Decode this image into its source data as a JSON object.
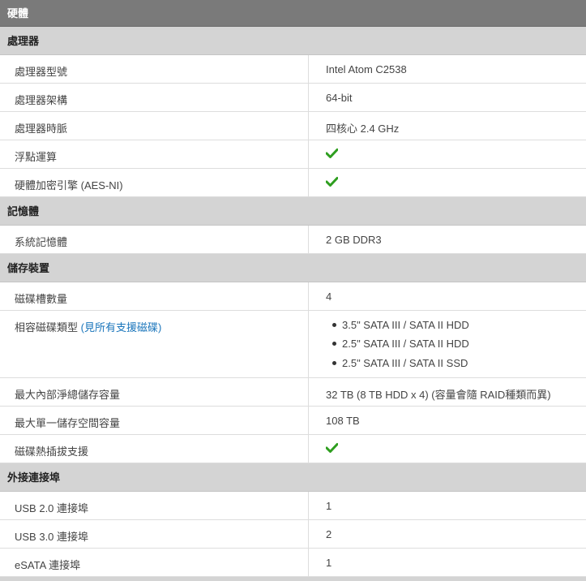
{
  "title": "硬體",
  "colors": {
    "check": "#2e9e1f",
    "link": "#1a75bb"
  },
  "sections": {
    "cpu": {
      "title": "處理器",
      "model_label": "處理器型號",
      "model_value": "Intel Atom C2538",
      "arch_label": "處理器架構",
      "arch_value": "64-bit",
      "freq_label": "處理器時脈",
      "freq_value": "四核心 2.4 GHz",
      "fpu_label": "浮點運算",
      "fpu_value_icon": "checkmark-icon",
      "aes_label": "硬體加密引擎 (AES-NI)",
      "aes_value_icon": "checkmark-icon"
    },
    "memory": {
      "title": "記憶體",
      "ram_label": "系統記憶體",
      "ram_value": "2 GB DDR3"
    },
    "storage": {
      "title": "儲存裝置",
      "bays_label": "磁碟槽數量",
      "bays_value": "4",
      "types_label": "相容磁碟類型",
      "types_link": "(見所有支援磁碟)",
      "types": [
        "3.5\" SATA III / SATA II HDD",
        "2.5\" SATA III / SATA II HDD",
        "2.5\" SATA III / SATA II SSD"
      ],
      "capacity_label": "最大內部淨總儲存容量",
      "capacity_value": "32 TB (8 TB HDD x 4) (容量會隨 RAID種類而異)",
      "single_label": "最大單一儲存空間容量",
      "single_value": "108 TB",
      "hotswap_label": "磁碟熱插拔支援",
      "hotswap_value_icon": "checkmark-icon"
    },
    "ports": {
      "title": "外接連接埠",
      "usb2_label": "USB 2.0 連接埠",
      "usb2_value": "1",
      "usb3_label": "USB 3.0 連接埠",
      "usb3_value": "2",
      "esata_label": "eSATA 連接埠",
      "esata_value": "1"
    }
  }
}
